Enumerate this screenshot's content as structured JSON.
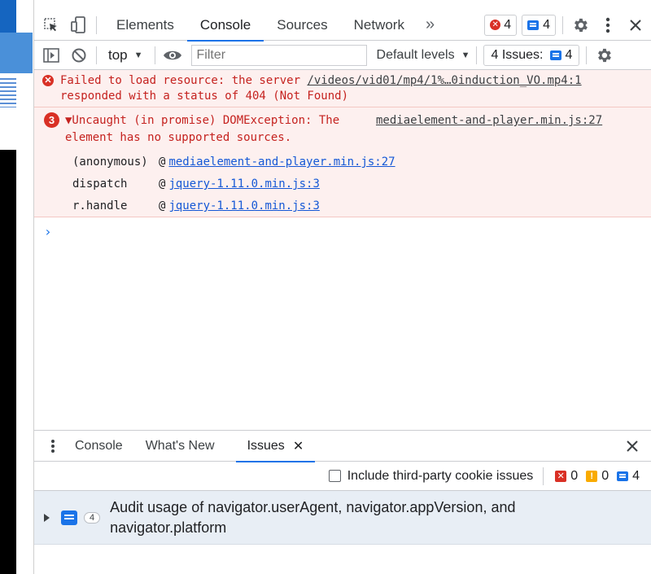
{
  "tabs": {
    "items": [
      "Elements",
      "Console",
      "Sources",
      "Network"
    ],
    "more_label": "»",
    "error_count": "4",
    "message_count": "4"
  },
  "toolbar": {
    "context": "top",
    "filter_placeholder": "Filter",
    "levels_label": "Default levels",
    "issues_label": "4 Issues:",
    "issues_count": "4"
  },
  "messages": {
    "m1": {
      "text_before": "Failed to load resource: the server ",
      "link": "/videos/vid01/mp4/1%…0induction_VO.mp4:1",
      "text_after": "responded with a status of 404 (Not Found)"
    },
    "m2": {
      "count": "3",
      "line1": "▼Uncaught (in promise) DOMException: The",
      "line2": "element has no supported sources.",
      "source": "mediaelement-and-player.min.js:27",
      "stack": [
        {
          "fn": "(anonymous)",
          "at": "@",
          "link": "mediaelement-and-player.min.js:27"
        },
        {
          "fn": "dispatch",
          "at": "@",
          "link": "jquery-1.11.0.min.js:3"
        },
        {
          "fn": "r.handle",
          "at": "@",
          "link": "jquery-1.11.0.min.js:3"
        }
      ]
    }
  },
  "prompt_symbol": "›",
  "drawer": {
    "tabs": [
      "Console",
      "What's New",
      "Issues"
    ],
    "close_tab": "✕",
    "include_label": "Include third-party cookie issues",
    "error_count": "0",
    "warning_count": "0",
    "info_count": "4",
    "issue": {
      "count": "4",
      "title": "Audit usage of navigator.userAgent, navigator.appVersion, and navigator.platform"
    }
  },
  "colors": {
    "accent": "#1a73e8",
    "error": "#d93025",
    "error_bg": "#fdf0ef",
    "issue_bg": "#e8eef5"
  }
}
